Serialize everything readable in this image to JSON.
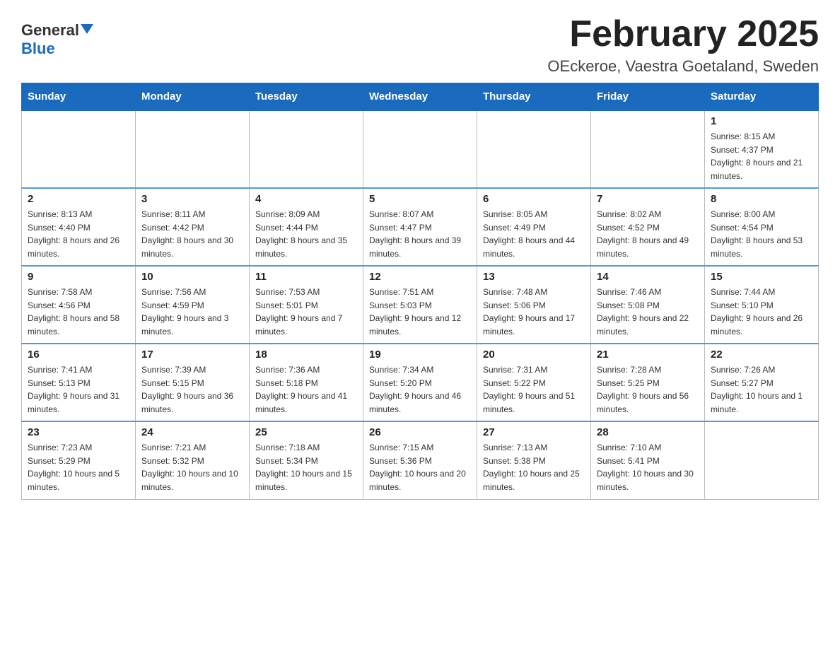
{
  "header": {
    "logo_general": "General",
    "logo_blue": "Blue",
    "month_title": "February 2025",
    "location": "OEckeroe, Vaestra Goetaland, Sweden"
  },
  "weekdays": [
    "Sunday",
    "Monday",
    "Tuesday",
    "Wednesday",
    "Thursday",
    "Friday",
    "Saturday"
  ],
  "weeks": [
    [
      {
        "day": "",
        "info": ""
      },
      {
        "day": "",
        "info": ""
      },
      {
        "day": "",
        "info": ""
      },
      {
        "day": "",
        "info": ""
      },
      {
        "day": "",
        "info": ""
      },
      {
        "day": "",
        "info": ""
      },
      {
        "day": "1",
        "info": "Sunrise: 8:15 AM\nSunset: 4:37 PM\nDaylight: 8 hours and 21 minutes."
      }
    ],
    [
      {
        "day": "2",
        "info": "Sunrise: 8:13 AM\nSunset: 4:40 PM\nDaylight: 8 hours and 26 minutes."
      },
      {
        "day": "3",
        "info": "Sunrise: 8:11 AM\nSunset: 4:42 PM\nDaylight: 8 hours and 30 minutes."
      },
      {
        "day": "4",
        "info": "Sunrise: 8:09 AM\nSunset: 4:44 PM\nDaylight: 8 hours and 35 minutes."
      },
      {
        "day": "5",
        "info": "Sunrise: 8:07 AM\nSunset: 4:47 PM\nDaylight: 8 hours and 39 minutes."
      },
      {
        "day": "6",
        "info": "Sunrise: 8:05 AM\nSunset: 4:49 PM\nDaylight: 8 hours and 44 minutes."
      },
      {
        "day": "7",
        "info": "Sunrise: 8:02 AM\nSunset: 4:52 PM\nDaylight: 8 hours and 49 minutes."
      },
      {
        "day": "8",
        "info": "Sunrise: 8:00 AM\nSunset: 4:54 PM\nDaylight: 8 hours and 53 minutes."
      }
    ],
    [
      {
        "day": "9",
        "info": "Sunrise: 7:58 AM\nSunset: 4:56 PM\nDaylight: 8 hours and 58 minutes."
      },
      {
        "day": "10",
        "info": "Sunrise: 7:56 AM\nSunset: 4:59 PM\nDaylight: 9 hours and 3 minutes."
      },
      {
        "day": "11",
        "info": "Sunrise: 7:53 AM\nSunset: 5:01 PM\nDaylight: 9 hours and 7 minutes."
      },
      {
        "day": "12",
        "info": "Sunrise: 7:51 AM\nSunset: 5:03 PM\nDaylight: 9 hours and 12 minutes."
      },
      {
        "day": "13",
        "info": "Sunrise: 7:48 AM\nSunset: 5:06 PM\nDaylight: 9 hours and 17 minutes."
      },
      {
        "day": "14",
        "info": "Sunrise: 7:46 AM\nSunset: 5:08 PM\nDaylight: 9 hours and 22 minutes."
      },
      {
        "day": "15",
        "info": "Sunrise: 7:44 AM\nSunset: 5:10 PM\nDaylight: 9 hours and 26 minutes."
      }
    ],
    [
      {
        "day": "16",
        "info": "Sunrise: 7:41 AM\nSunset: 5:13 PM\nDaylight: 9 hours and 31 minutes."
      },
      {
        "day": "17",
        "info": "Sunrise: 7:39 AM\nSunset: 5:15 PM\nDaylight: 9 hours and 36 minutes."
      },
      {
        "day": "18",
        "info": "Sunrise: 7:36 AM\nSunset: 5:18 PM\nDaylight: 9 hours and 41 minutes."
      },
      {
        "day": "19",
        "info": "Sunrise: 7:34 AM\nSunset: 5:20 PM\nDaylight: 9 hours and 46 minutes."
      },
      {
        "day": "20",
        "info": "Sunrise: 7:31 AM\nSunset: 5:22 PM\nDaylight: 9 hours and 51 minutes."
      },
      {
        "day": "21",
        "info": "Sunrise: 7:28 AM\nSunset: 5:25 PM\nDaylight: 9 hours and 56 minutes."
      },
      {
        "day": "22",
        "info": "Sunrise: 7:26 AM\nSunset: 5:27 PM\nDaylight: 10 hours and 1 minute."
      }
    ],
    [
      {
        "day": "23",
        "info": "Sunrise: 7:23 AM\nSunset: 5:29 PM\nDaylight: 10 hours and 5 minutes."
      },
      {
        "day": "24",
        "info": "Sunrise: 7:21 AM\nSunset: 5:32 PM\nDaylight: 10 hours and 10 minutes."
      },
      {
        "day": "25",
        "info": "Sunrise: 7:18 AM\nSunset: 5:34 PM\nDaylight: 10 hours and 15 minutes."
      },
      {
        "day": "26",
        "info": "Sunrise: 7:15 AM\nSunset: 5:36 PM\nDaylight: 10 hours and 20 minutes."
      },
      {
        "day": "27",
        "info": "Sunrise: 7:13 AM\nSunset: 5:38 PM\nDaylight: 10 hours and 25 minutes."
      },
      {
        "day": "28",
        "info": "Sunrise: 7:10 AM\nSunset: 5:41 PM\nDaylight: 10 hours and 30 minutes."
      },
      {
        "day": "",
        "info": ""
      }
    ]
  ]
}
